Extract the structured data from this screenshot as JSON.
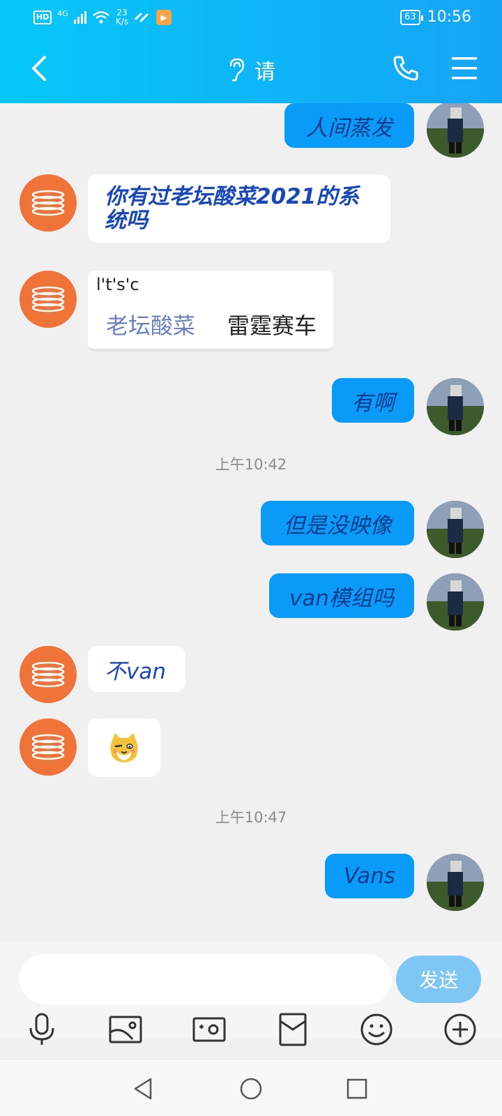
{
  "status_bar": {
    "hd": "HD",
    "network": "4G",
    "speed_value": "23",
    "speed_unit": "K/s",
    "battery": "63",
    "time": "10:56"
  },
  "header": {
    "title": "请"
  },
  "messages": [
    {
      "side": "me",
      "text": "人间蒸发"
    },
    {
      "side": "bot",
      "text": "你有过老坛酸菜2021的系统吗"
    },
    {
      "side": "bot",
      "type": "card",
      "top": "l't's'c",
      "option_a": "老坛酸菜",
      "option_b": "雷霆赛车"
    },
    {
      "side": "me",
      "text": "有啊"
    },
    {
      "type": "time",
      "text": "上午10:42"
    },
    {
      "side": "me",
      "text": "但是没映像"
    },
    {
      "side": "me",
      "text": "van模组吗"
    },
    {
      "side": "bot",
      "text": "不van"
    },
    {
      "side": "bot",
      "type": "sticker",
      "icon": "cat-sticker"
    },
    {
      "type": "time",
      "text": "上午10:47"
    },
    {
      "side": "me",
      "text": "Vans"
    }
  ],
  "input": {
    "value": "",
    "send_label": "发送"
  },
  "colors": {
    "header_start": "#06c8f7",
    "header_end": "#15a4f7",
    "my_bubble": "#0a9bf9",
    "bot_avatar": "#f0733a",
    "send_button": "#7ec7f5"
  }
}
